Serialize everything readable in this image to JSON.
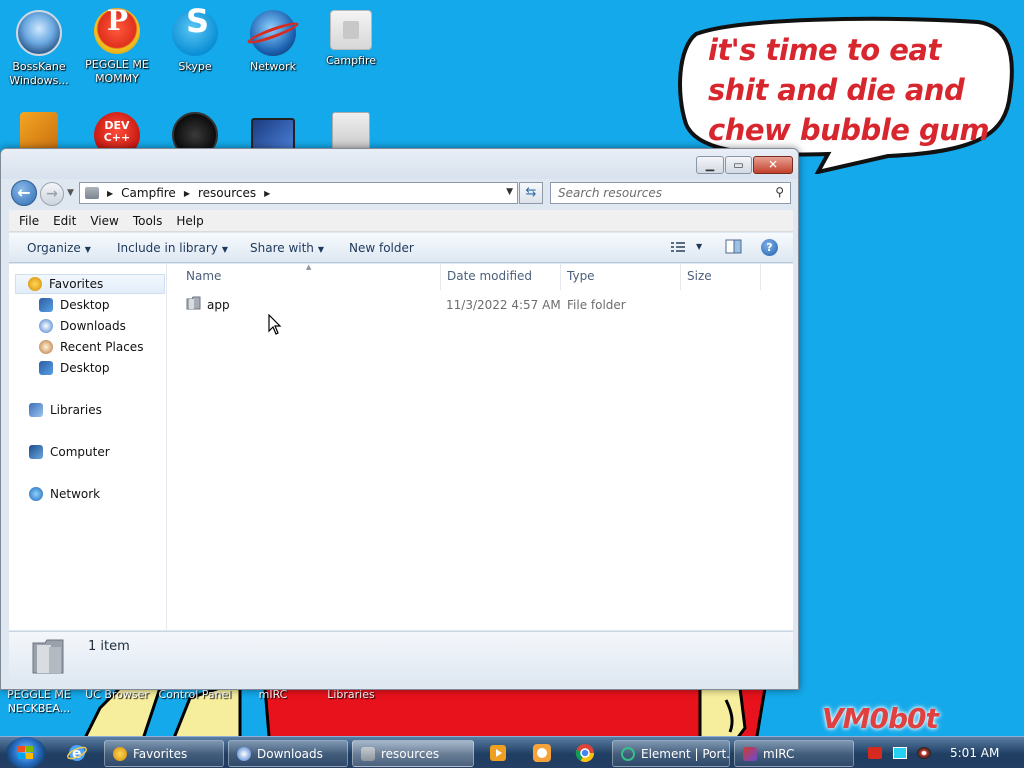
{
  "desktop": {
    "icons_top": [
      {
        "label": "BossKane\nWindows..."
      },
      {
        "label": "PEGGLE ME\nMOMMY"
      },
      {
        "label": "Skype"
      },
      {
        "label": "Network"
      },
      {
        "label": "Campfire"
      }
    ],
    "icons_second_row": {
      "dev_label": "DEV C++"
    },
    "icons_bottom": [
      {
        "label": "PEGGLE ME\nNECKBEA..."
      },
      {
        "label": "UC Browser"
      },
      {
        "label": "Control Panel"
      },
      {
        "label": "mIRC"
      },
      {
        "label": "Libraries"
      }
    ],
    "bubble_text": "it's time to eat shit and die and chew bubble gum",
    "watermark": "VM0b0t",
    "colors": {
      "background": "#14a9ea",
      "bubble_text": "#d8262e"
    }
  },
  "window": {
    "breadcrumb": [
      "Campfire",
      "resources"
    ],
    "search_placeholder": "Search resources",
    "menu": [
      "File",
      "Edit",
      "View",
      "Tools",
      "Help"
    ],
    "toolbar": {
      "organize": "Organize",
      "include_in_library": "Include in library",
      "share_with": "Share with",
      "new_folder": "New folder"
    },
    "nav_pane": {
      "favorites": "Favorites",
      "favorites_items": [
        "Desktop",
        "Downloads",
        "Recent Places",
        "Desktop"
      ],
      "libraries": "Libraries",
      "computer": "Computer",
      "network": "Network"
    },
    "columns": {
      "name": "Name",
      "date": "Date modified",
      "type": "Type",
      "size": "Size"
    },
    "files": [
      {
        "name": "app",
        "date": "11/3/2022 4:57 AM",
        "type": "File folder",
        "size": ""
      }
    ],
    "status": "1 item"
  },
  "taskbar": {
    "tasks": [
      {
        "label": "Favorites"
      },
      {
        "label": "Downloads"
      },
      {
        "label": "resources"
      },
      {
        "label": "Element | Port..."
      },
      {
        "label": "mIRC"
      }
    ],
    "clock": "5:01 AM"
  }
}
